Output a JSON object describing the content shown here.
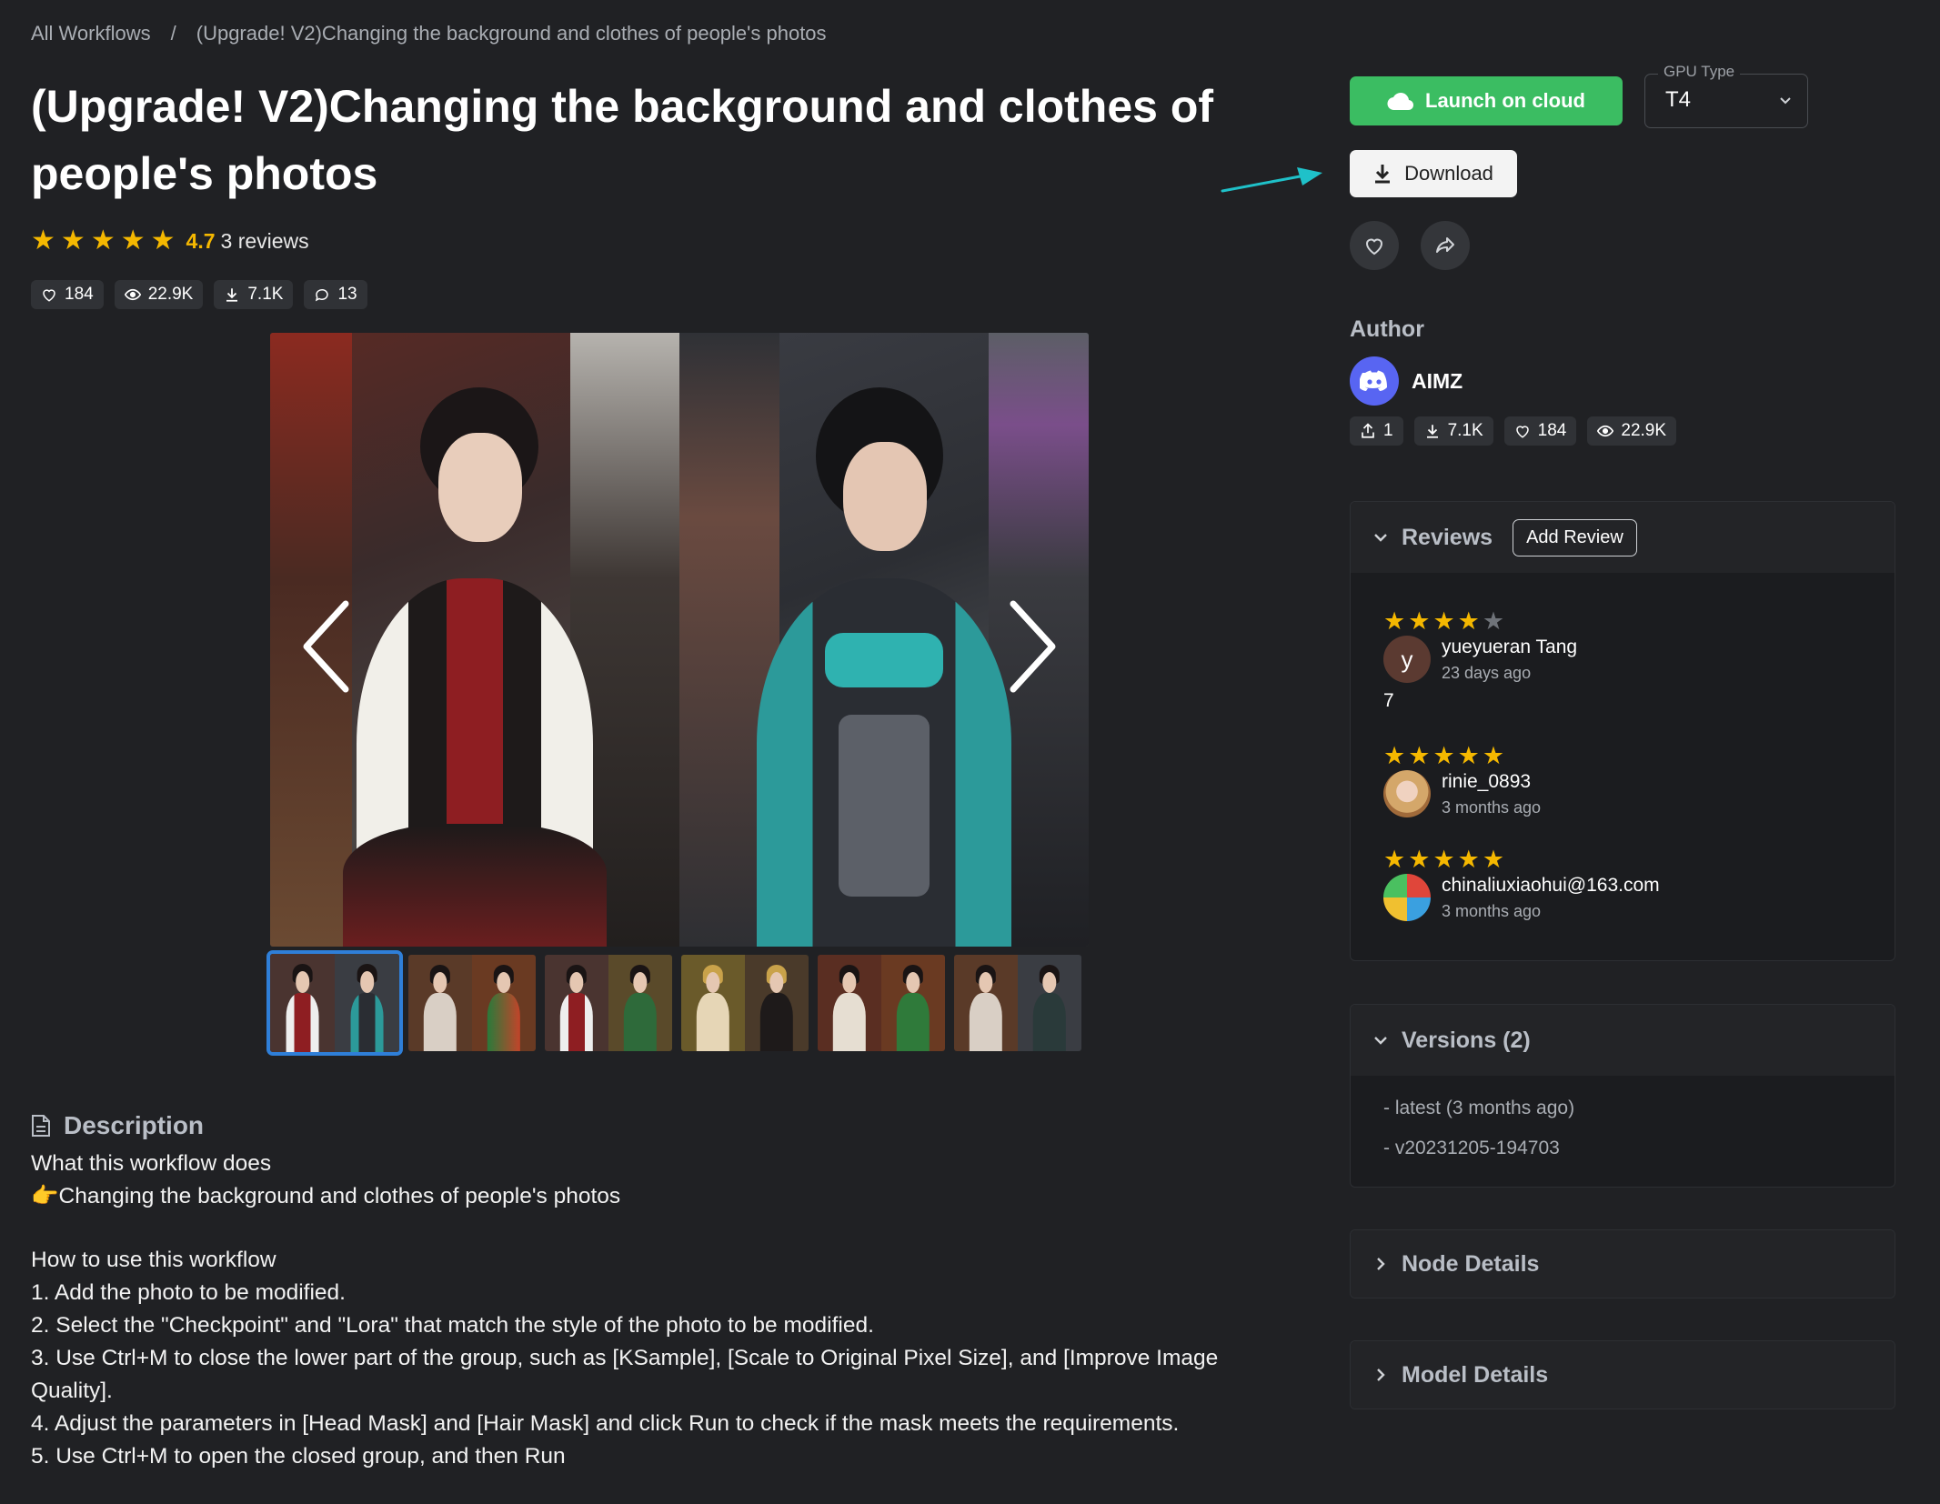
{
  "breadcrumb": {
    "root": "All Workflows",
    "sep": "/",
    "current": "(Upgrade! V2)Changing the background and clothes of people's photos"
  },
  "title": "(Upgrade! V2)Changing the background and clothes of people's photos",
  "rating": {
    "value": "4.7",
    "stars": 5,
    "reviews_label": "3 reviews"
  },
  "stats": {
    "likes": "184",
    "views": "22.9K",
    "downloads": "7.1K",
    "comments": "13"
  },
  "description": {
    "heading": "Description",
    "line1": "What this workflow does",
    "line2": "👉Changing the background and clothes of people's photos",
    "line3": "How to use this workflow",
    "step1": "1. Add the photo to be modified.",
    "step2": "2. Select the \"Checkpoint\" and \"Lora\" that match the style of the photo to be modified.",
    "step3": "3. Use Ctrl+M to close the lower part of the group, such as [KSample], [Scale to Original Pixel Size], and [Improve Image Quality].",
    "step4": "4. Adjust the parameters in [Head Mask] and [Hair Mask] and click Run to check if the mask meets the requirements.",
    "step5": "5. Use Ctrl+M to open the closed group, and then Run"
  },
  "actions": {
    "launch": "Launch on cloud",
    "gpu_label": "GPU Type",
    "gpu_value": "T4",
    "download": "Download"
  },
  "author": {
    "heading": "Author",
    "name": "AIMZ",
    "workflows": "1",
    "downloads": "7.1K",
    "likes": "184",
    "views": "22.9K"
  },
  "reviews": {
    "heading": "Reviews",
    "add_label": "Add Review",
    "items": [
      {
        "stars": 4,
        "initial": "y",
        "name": "yueyueran Tang",
        "date": "23 days ago",
        "body": "7"
      },
      {
        "stars": 5,
        "initial": "",
        "name": "rinie_0893",
        "date": "3 months ago",
        "body": ""
      },
      {
        "stars": 5,
        "initial": "",
        "name": "chinaliuxiaohui@163.com",
        "date": "3 months ago",
        "body": ""
      }
    ]
  },
  "versions": {
    "heading": "Versions (2)",
    "items": [
      "- latest (3 months ago)",
      "- v20231205-194703"
    ]
  },
  "node_details": {
    "heading": "Node Details"
  },
  "model_details": {
    "heading": "Model Details"
  },
  "colors": {
    "accent_green": "#3bbd62",
    "star": "#f5b800",
    "discord": "#5865f2",
    "thumb_active": "#2f7fd8"
  }
}
